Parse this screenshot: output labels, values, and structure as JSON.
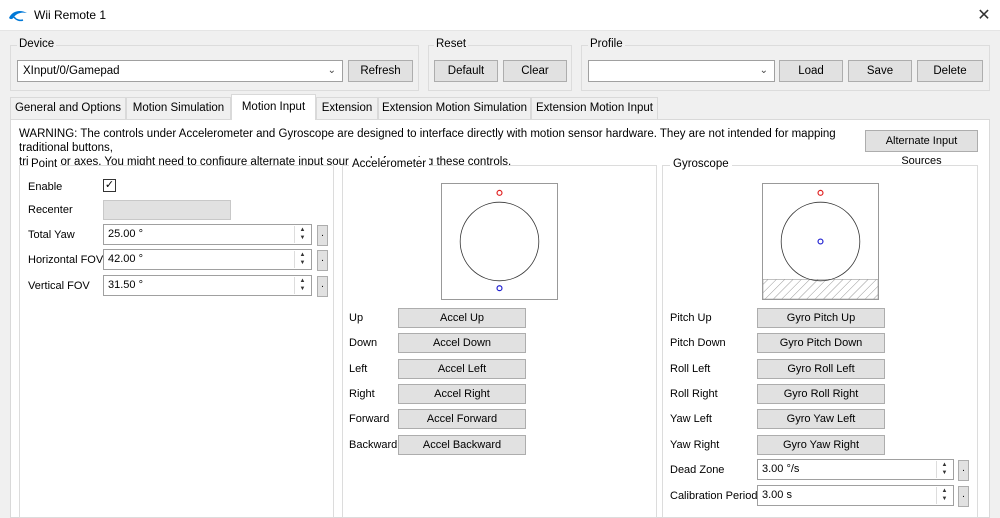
{
  "window": {
    "title": "Wii Remote 1",
    "close_glyph": "✕"
  },
  "device": {
    "group_label": "Device",
    "selected": "XInput/0/Gamepad",
    "refresh_label": "Refresh"
  },
  "reset": {
    "group_label": "Reset",
    "default_label": "Default",
    "clear_label": "Clear"
  },
  "profile": {
    "group_label": "Profile",
    "selected": "",
    "load_label": "Load",
    "save_label": "Save",
    "delete_label": "Delete"
  },
  "tabs": [
    {
      "label": "General and Options",
      "active": false
    },
    {
      "label": "Motion Simulation",
      "active": false
    },
    {
      "label": "Motion Input",
      "active": true
    },
    {
      "label": "Extension",
      "active": false
    },
    {
      "label": "Extension Motion Simulation",
      "active": false
    },
    {
      "label": "Extension Motion Input",
      "active": false
    }
  ],
  "warning": {
    "line1": "WARNING: The controls under Accelerometer and Gyroscope are designed to interface directly with motion sensor hardware. They are not intended for mapping traditional buttons,",
    "line2": "triggers or axes. You might need to configure alternate input sources before using these controls.",
    "alternate_label": "Alternate Input Sources"
  },
  "point": {
    "group_label": "Point",
    "enable_label": "Enable",
    "enable_checked": true,
    "recenter_label": "Recenter",
    "total_yaw_label": "Total Yaw",
    "total_yaw_value": "25.00 °",
    "horizontal_fov_label": "Horizontal FOV",
    "horizontal_fov_value": "42.00 °",
    "vertical_fov_label": "Vertical FOV",
    "vertical_fov_value": "31.50 °",
    "dot_label": "."
  },
  "accelerometer": {
    "group_label": "Accelerometer",
    "rows": [
      {
        "label": "Up",
        "binding": "Accel Up"
      },
      {
        "label": "Down",
        "binding": "Accel Down"
      },
      {
        "label": "Left",
        "binding": "Accel Left"
      },
      {
        "label": "Right",
        "binding": "Accel Right"
      },
      {
        "label": "Forward",
        "binding": "Accel Forward"
      },
      {
        "label": "Backward",
        "binding": "Accel Backward"
      }
    ]
  },
  "gyroscope": {
    "group_label": "Gyroscope",
    "rows": [
      {
        "label": "Pitch Up",
        "binding": "Gyro Pitch Up"
      },
      {
        "label": "Pitch Down",
        "binding": "Gyro Pitch Down"
      },
      {
        "label": "Roll Left",
        "binding": "Gyro Roll Left"
      },
      {
        "label": "Roll Right",
        "binding": "Gyro Roll Right"
      },
      {
        "label": "Yaw Left",
        "binding": "Gyro Yaw Left"
      },
      {
        "label": "Yaw Right",
        "binding": "Gyro Yaw Right"
      }
    ],
    "dead_zone_label": "Dead Zone",
    "dead_zone_value": "3.00 °/s",
    "calibration_label": "Calibration Period",
    "calibration_value": "3.00 s"
  },
  "colors": {
    "accent_blue": "#0078d7",
    "marker_red": "#e02020",
    "marker_blue": "#2020d0"
  },
  "icons": {
    "app": "dolphin-logo-icon",
    "close": "close-icon",
    "dropdown": "chevron-down-icon",
    "check": "check-icon"
  }
}
